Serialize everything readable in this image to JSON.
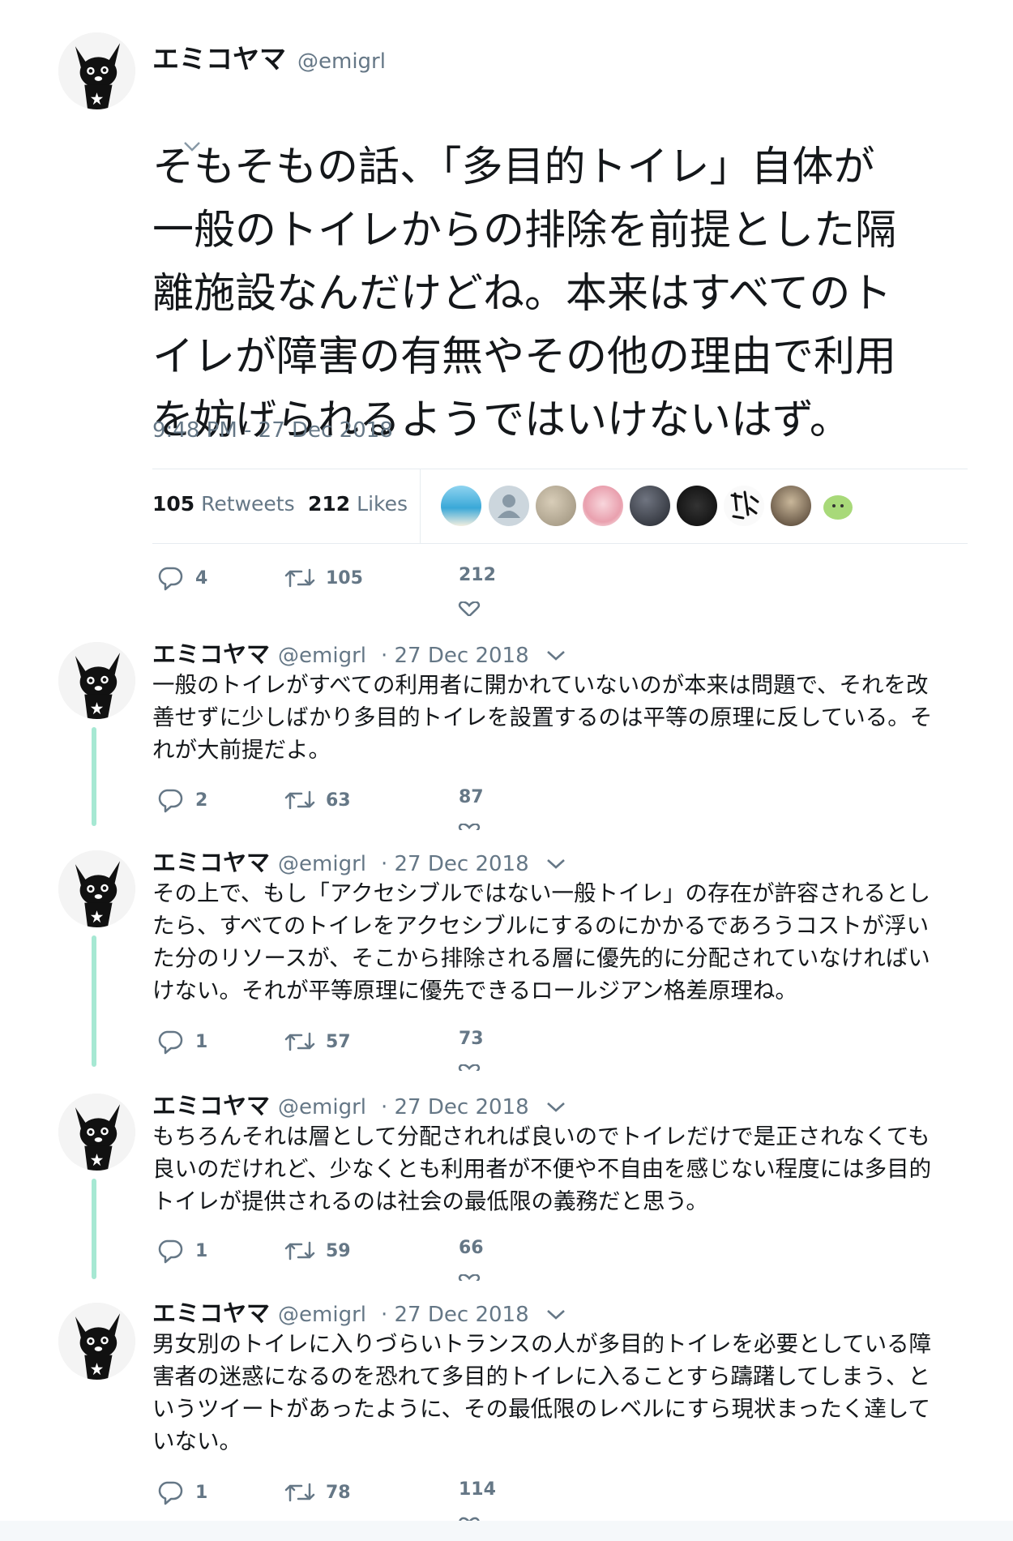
{
  "main_tweet": {
    "author_name": "エミコヤマ",
    "author_handle": "@emigrl",
    "text_lines": [
      "そもそもの話、「多目的トイレ」自体が",
      "一般のトイレからの排除を前提とした隔",
      "離施設なんだけどね。本来はすべてのト",
      "イレが障害の有無やその他の理由で利用",
      "を妨げられるようではいけないはず。"
    ],
    "timestamp": "9:48 PM - 27 Dec 2018",
    "retweets_count": "105",
    "retweets_label": "Retweets",
    "likes_count": "212",
    "likes_label": "Likes",
    "actions": {
      "replies": "4",
      "retweets": "105",
      "likes": "212"
    }
  },
  "replies": [
    {
      "author_name": "エミコヤマ",
      "author_handle": "@emigrl",
      "date": "· 27 Dec 2018",
      "text_lines": [
        "一般のトイレがすべての利用者に開かれていないのが本来は問題で、それを改",
        "善せずに少しばかり多目的トイレを設置するのは平等の原理に反している。そ",
        "れが大前提だよ。"
      ],
      "replies": "2",
      "retweets": "63",
      "likes": "87"
    },
    {
      "author_name": "エミコヤマ",
      "author_handle": "@emigrl",
      "date": "· 27 Dec 2018",
      "text_lines": [
        "その上で、もし「アクセシブルではない一般トイレ」の存在が許容されるとし",
        "たら、すべてのトイレをアクセシブルにするのにかかるであろうコストが浮い",
        "た分のリソースが、そこから排除される層に優先的に分配されていなければい",
        "けない。それが平等原理に優先できるロールジアン格差原理ね。"
      ],
      "replies": "1",
      "retweets": "57",
      "likes": "73"
    },
    {
      "author_name": "エミコヤマ",
      "author_handle": "@emigrl",
      "date": "· 27 Dec 2018",
      "text_lines": [
        "もちろんそれは層として分配されれば良いのでトイレだけで是正されなくても",
        "良いのだけれど、少なくとも利用者が不便や不自由を感じない程度には多目的",
        "トイレが提供されるのは社会の最低限の義務だと思う。"
      ],
      "replies": "1",
      "retweets": "59",
      "likes": "66"
    },
    {
      "author_name": "エミコヤマ",
      "author_handle": "@emigrl",
      "date": "· 27 Dec 2018",
      "text_lines": [
        "男女別のトイレに入りづらいトランスの人が多目的トイレを必要としている障",
        "害者の迷惑になるのを恐れて多目的トイレに入ることすら躊躇してしまう、と",
        "いうツイートがあったように、その最低限のレベルにすら現状まったく達して",
        "いない。"
      ],
      "replies": "1",
      "retweets": "78",
      "likes": "114"
    }
  ],
  "colors": {
    "text": "#14171a",
    "secondary": "#657786",
    "thread_line": "#a6e8d3",
    "divider": "#e6ecf0"
  }
}
